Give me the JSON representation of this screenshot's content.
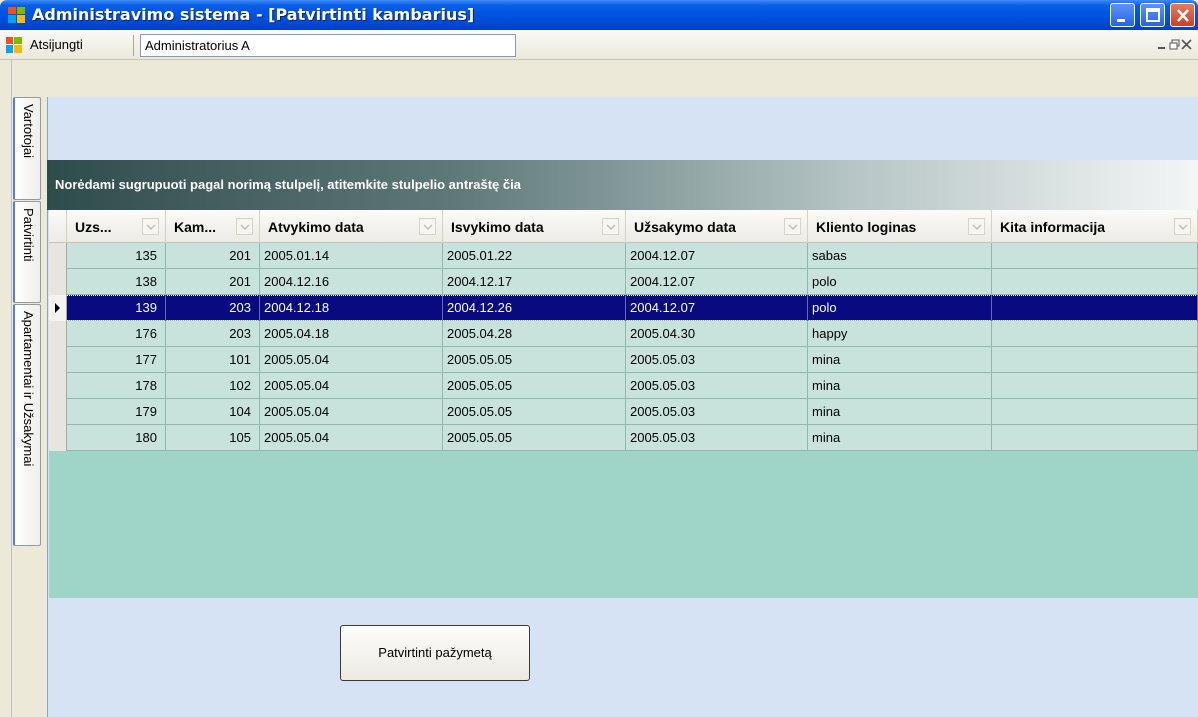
{
  "window": {
    "title": "Administravimo sistema - [Patvirtinti kambarius]"
  },
  "menu": {
    "logout_label": "Atsijungti",
    "user_value": "Administratorius A"
  },
  "side_tabs": [
    "Vartotojai",
    "Patvirtinti",
    "Apartamentai ir Užsakymai"
  ],
  "group_panel": {
    "text": "Norėdami sugrupuoti pagal norimą stulpelį, atitemkite stulpelio antraštę čia"
  },
  "grid": {
    "columns": [
      "Uzs...",
      "Kam...",
      "Atvykimo data",
      "Isvykimo data",
      "Užsakymo data",
      "Kliento loginas",
      "Kita informacija"
    ],
    "rows": [
      [
        "135",
        "201",
        "2005.01.14",
        "2005.01.22",
        "2004.12.07",
        "sabas",
        ""
      ],
      [
        "138",
        "201",
        "2004.12.16",
        "2004.12.17",
        "2004.12.07",
        "polo",
        ""
      ],
      [
        "139",
        "203",
        "2004.12.18",
        "2004.12.26",
        "2004.12.07",
        "polo",
        ""
      ],
      [
        "176",
        "203",
        "2005.04.18",
        "2005.04.28",
        "2005.04.30",
        "happy",
        ""
      ],
      [
        "177",
        "101",
        "2005.05.04",
        "2005.05.05",
        "2005.05.03",
        "mina",
        ""
      ],
      [
        "178",
        "102",
        "2005.05.04",
        "2005.05.05",
        "2005.05.03",
        "mina",
        ""
      ],
      [
        "179",
        "104",
        "2005.05.04",
        "2005.05.05",
        "2005.05.03",
        "mina",
        ""
      ],
      [
        "180",
        "105",
        "2005.05.04",
        "2005.05.05",
        "2005.05.03",
        "mina",
        ""
      ]
    ],
    "selected_row": 2
  },
  "buttons": {
    "confirm_label": "Patvirtinti pažymetą"
  },
  "colors": {
    "titlebar": "#0054e3",
    "grid_bg": "#9fd5c9",
    "row_bg": "#c8e3db",
    "selected_row": "#0a0a80",
    "panel_bg": "#d6e3f5"
  },
  "icons": {
    "app": "windows-app-icon",
    "minimize": "minimize-icon",
    "maximize": "maximize-icon",
    "close": "close-icon",
    "dropdown": "chevron-down-icon"
  }
}
